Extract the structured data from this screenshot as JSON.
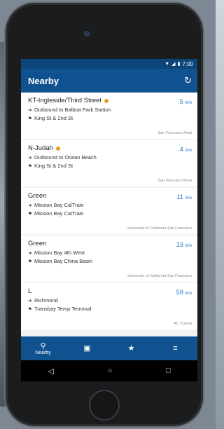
{
  "status": {
    "time": "7:00",
    "icons": [
      "wifi-icon",
      "signal-icon",
      "battery-icon"
    ]
  },
  "header": {
    "title": "Nearby",
    "refresh_icon": "refresh-icon"
  },
  "routes": [
    {
      "name": "KT-Ingleside/Third Street",
      "alert": true,
      "direction": "Outbound to Balboa Park Station",
      "stop": "King St & 2nd St",
      "eta": "5",
      "unit": "min",
      "live": true,
      "agency": "San Francisco Muni"
    },
    {
      "name": "N-Judah",
      "alert": true,
      "direction": "Outbound to Ocean Beach",
      "stop": "King St & 2nd St",
      "eta": "4",
      "unit": "min",
      "live": true,
      "agency": "San Francisco Muni"
    },
    {
      "name": "Green",
      "alert": false,
      "direction": "Mission Bay CalTrain",
      "stop": "Mission Bay CalTrain",
      "eta": "11",
      "unit": "min",
      "live": false,
      "agency": "University of California San Francisco"
    },
    {
      "name": "Green",
      "alert": false,
      "direction": "Mission Bay 4th West",
      "stop": "Mission Bay China Basin",
      "eta": "13",
      "unit": "min",
      "live": false,
      "agency": "University of California San Francisco"
    },
    {
      "name": "L",
      "alert": false,
      "direction": "Richmond",
      "stop": "Transbay Temp Terminal",
      "eta": "59",
      "unit": "min",
      "live": false,
      "agency": "AC Transit"
    }
  ],
  "bottom_nav": {
    "nearby": "Nearby",
    "icons": [
      "location-pin-icon",
      "bus-icon",
      "star-icon",
      "menu-icon"
    ]
  },
  "colors": {
    "primary": "#10528f",
    "statusbar": "#0d4479",
    "eta": "#1b74c6",
    "alert": "#f29a1f"
  }
}
